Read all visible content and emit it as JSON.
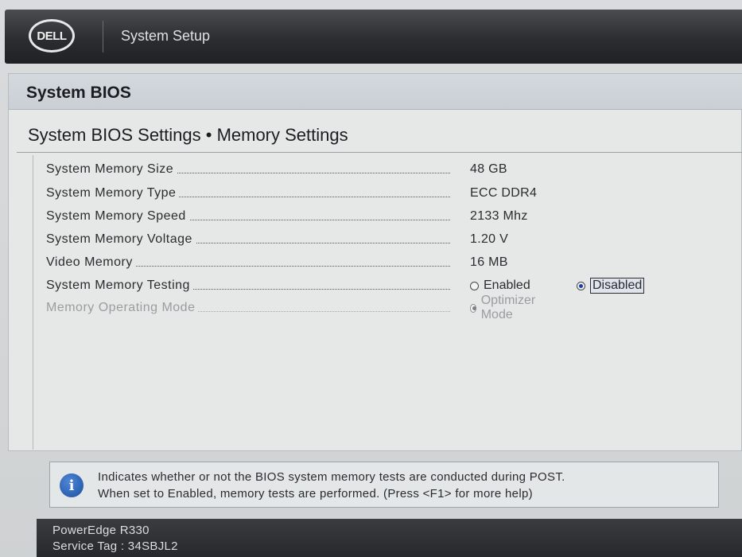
{
  "header": {
    "logo_text": "DELL",
    "title": "System Setup"
  },
  "page": {
    "title": "System BIOS",
    "section_title": "System BIOS Settings • Memory Settings"
  },
  "settings": [
    {
      "label": "System Memory Size",
      "value": "48 GB"
    },
    {
      "label": "System Memory Type",
      "value": "ECC DDR4"
    },
    {
      "label": "System Memory Speed",
      "value": "2133 Mhz"
    },
    {
      "label": "System Memory Voltage",
      "value": "1.20 V"
    },
    {
      "label": "Video Memory",
      "value": "16 MB"
    }
  ],
  "memory_testing": {
    "label": "System Memory Testing",
    "options": [
      {
        "label": "Enabled",
        "selected": false
      },
      {
        "label": "Disabled",
        "selected": true
      }
    ]
  },
  "memory_operating_mode": {
    "label": "Memory Operating Mode",
    "option": "Optimizer Mode",
    "disabled": true
  },
  "help": {
    "line1": "Indicates whether or not the BIOS system memory tests are conducted during POST.",
    "line2": "When set to Enabled, memory tests are performed. (Press <F1> for more help)"
  },
  "footer": {
    "model": "PowerEdge R330",
    "service_tag": "Service Tag : 34SBJL2"
  },
  "colors": {
    "header_bg": "#2b2d31",
    "panel_bg": "#e6e8e8",
    "radio_selected": "#1f3ea8",
    "info_icon": "#1b4fa0"
  }
}
